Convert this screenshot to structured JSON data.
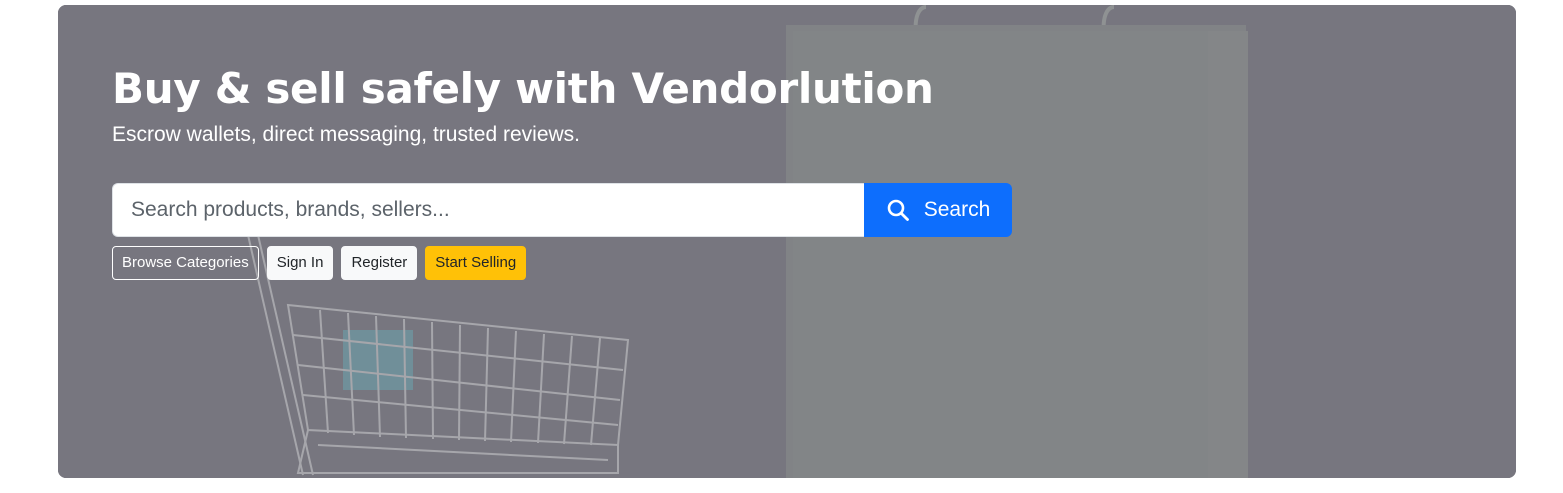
{
  "hero": {
    "title": "Buy & sell safely with Vendorlution",
    "subtitle": "Escrow wallets, direct messaging, trusted reviews.",
    "background_image": "shopping-cart-and-paper-bag-photo",
    "overlay_color": "#7a7982"
  },
  "search": {
    "placeholder": "Search products, brands, sellers...",
    "value": "",
    "button_label": "Search",
    "icon": "search-icon",
    "button_color": "#0d6efd"
  },
  "actions": {
    "browse_categories": "Browse Categories",
    "sign_in": "Sign In",
    "register": "Register",
    "start_selling": "Start Selling",
    "start_selling_color": "#ffc107"
  }
}
